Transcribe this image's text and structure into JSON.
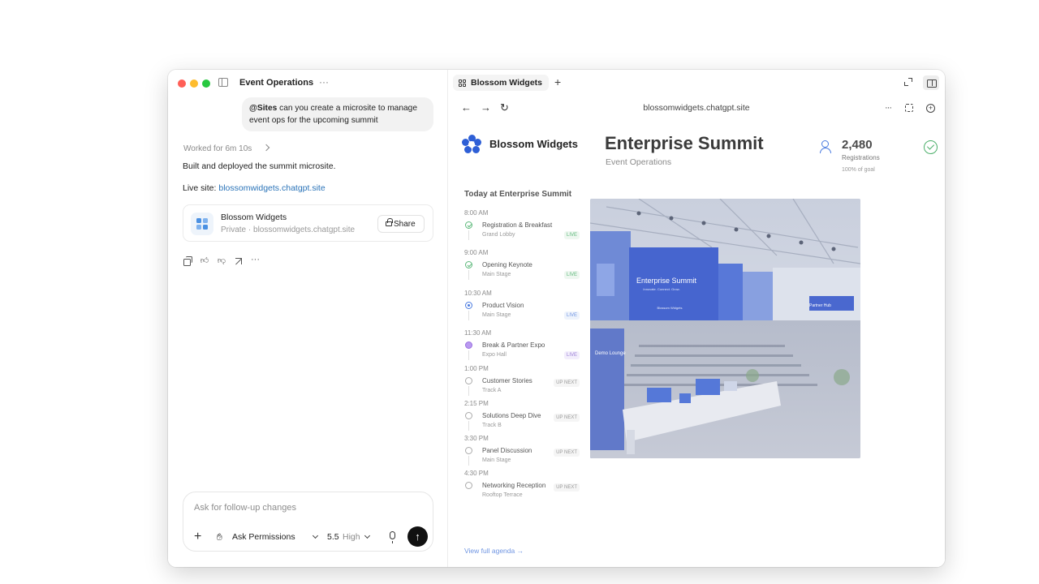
{
  "chat": {
    "title": "Event Operations",
    "more": "···",
    "user_mention": "@Sites",
    "user_message": " can you create a microsite to manage event ops for the upcoming summit",
    "worked": "Worked for 6m 10s",
    "built": "Built and deployed the summit microsite.",
    "live_site_label": "Live site: ",
    "live_site_url": "blossomwidgets.chatgpt.site",
    "card": {
      "name": "Blossom Widgets",
      "sub": "Private · blossomwidgets.chatgpt.site",
      "share": "Share"
    },
    "composer": {
      "placeholder": "Ask for follow-up changes",
      "permissions": "Ask Permissions",
      "model_version": "5.5",
      "model_level": "High"
    }
  },
  "browser": {
    "tab": "Blossom Widgets",
    "url": "blossomwidgets.chatgpt.site"
  },
  "site": {
    "logo_text": "Blossom Widgets",
    "title": "Enterprise Summit",
    "subtitle": "Event Operations",
    "registrations": {
      "count": "2,480",
      "label": "Registrations",
      "goal": "100% of goal"
    },
    "agenda_title": "Today at Enterprise Summit",
    "agenda": [
      {
        "time": "8:00 AM",
        "name": "Registration & Breakfast",
        "location": "Grand Lobby",
        "badge": "LIVE",
        "state": "done"
      },
      {
        "time": "9:00 AM",
        "name": "Opening Keynote",
        "location": "Main Stage",
        "badge": "LIVE",
        "state": "done"
      },
      {
        "time": "10:30 AM",
        "name": "Product Vision",
        "location": "Main Stage",
        "badge": "LIVE",
        "state": "current"
      },
      {
        "time": "11:30 AM",
        "name": "Break & Partner Expo",
        "location": "Expo Hall",
        "badge": "LIVE",
        "state": "break"
      },
      {
        "time": "1:00 PM",
        "name": "Customer Stories",
        "location": "Track A",
        "badge": "UP NEXT",
        "state": "next"
      },
      {
        "time": "2:15 PM",
        "name": "Solutions Deep Dive",
        "location": "Track B",
        "badge": "UP NEXT",
        "state": "next"
      },
      {
        "time": "3:30 PM",
        "name": "Panel Discussion",
        "location": "Main Stage",
        "badge": "UP NEXT",
        "state": "next"
      },
      {
        "time": "4:30 PM",
        "name": "Networking Reception",
        "location": "Rooftop Terrace",
        "badge": "UP NEXT",
        "state": "next"
      }
    ],
    "view_agenda": "View full agenda →",
    "hero": {
      "screen_title": "Enterprise Summit",
      "screen_tagline": "Innovate. Connect. Grow.",
      "screen_brand": "Blossom Widgets",
      "demo_sign": "Demo Lounge",
      "partner_sign": "Partner Hub"
    }
  }
}
